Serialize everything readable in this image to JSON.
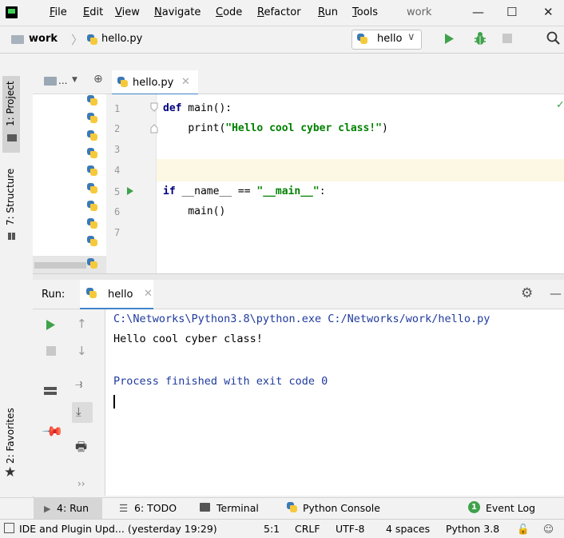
{
  "menu": {
    "items": [
      "File",
      "Edit",
      "View",
      "Navigate",
      "Code",
      "Refactor",
      "Run",
      "Tools"
    ],
    "project_name": "work"
  },
  "window_controls": {
    "minimize": "—",
    "maximize": "☐",
    "close": "✕"
  },
  "navbar": {
    "project": "work",
    "file": "hello.py",
    "run_config": "hello"
  },
  "left_stripe": {
    "project_label": "1: Project",
    "structure_label": "7: Structure",
    "favorites_label": "2: Favorites"
  },
  "project_panel": {
    "dropdown_label": "..."
  },
  "editor": {
    "tab_label": "hello.py",
    "line_numbers": [
      "1",
      "2",
      "3",
      "4",
      "5",
      "6",
      "7"
    ],
    "lines": [
      {
        "kw": "def",
        "rest": " main():"
      },
      {
        "indent": "    ",
        "text": "print(",
        "str": "\"Hello cool cyber class!\"",
        "tail": ")"
      },
      {
        "text": ""
      },
      {
        "text": ""
      },
      {
        "kw": "if",
        "rest": " __name__ == ",
        "str": "\"__main__\"",
        "tail": ":"
      },
      {
        "indent": "    ",
        "text": "main()"
      },
      {
        "text": ""
      }
    ]
  },
  "run_panel": {
    "title": "Run:",
    "tab_label": "hello",
    "console": [
      "C:\\Networks\\Python3.8\\python.exe C:/Networks/work/hello.py",
      "Hello cool cyber class!",
      "",
      "Process finished with exit code 0"
    ]
  },
  "bottom_tools": {
    "run": "4: Run",
    "todo": "6: TODO",
    "terminal": "Terminal",
    "python_console": "Python Console",
    "event_log": "Event Log",
    "event_count": "1"
  },
  "status_bar": {
    "message": "IDE and Plugin Upd... (yesterday 19:29)",
    "position": "5:1",
    "line_sep": "CRLF",
    "encoding": "UTF-8",
    "indent": "4 spaces",
    "interpreter": "Python 3.8"
  },
  "colors": {
    "run_green": "#3fa24b",
    "keyword": "#000080",
    "string": "#008000",
    "console_blue": "#1f3a9e",
    "accent": "#4083c9"
  }
}
